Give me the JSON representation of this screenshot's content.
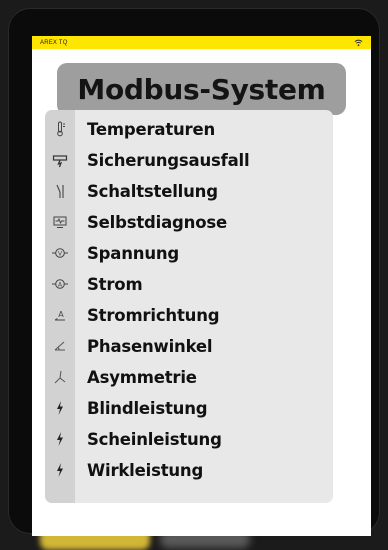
{
  "status_bar": {
    "title": "AREX TQ",
    "icon": "wifi-icon"
  },
  "header": {
    "title": "Modbus-System"
  },
  "menu": {
    "items": [
      {
        "label": "Temperaturen",
        "icon": "thermometer-icon"
      },
      {
        "label": "Sicherungsausfall",
        "icon": "fuse-icon"
      },
      {
        "label": "Schaltstellung",
        "icon": "switch-icon"
      },
      {
        "label": "Selbstdiagnose",
        "icon": "monitor-icon"
      },
      {
        "label": "Spannung",
        "icon": "voltmeter-icon"
      },
      {
        "label": "Strom",
        "icon": "ammeter-icon"
      },
      {
        "label": "Stromrichtung",
        "icon": "current-direction-icon"
      },
      {
        "label": "Phasenwinkel",
        "icon": "phase-angle-icon"
      },
      {
        "label": "Asymmetrie",
        "icon": "asymmetry-icon"
      },
      {
        "label": "Blindleistung",
        "icon": "lightning-icon"
      },
      {
        "label": "Scheinleistung",
        "icon": "lightning-icon"
      },
      {
        "label": "Wirkleistung",
        "icon": "lightning-icon"
      }
    ]
  },
  "colors": {
    "status_bar": "#ffe600",
    "title_box": "#9e9e9e",
    "panel": "#e8e8e8",
    "icon_strip": "#d2d2d2"
  }
}
